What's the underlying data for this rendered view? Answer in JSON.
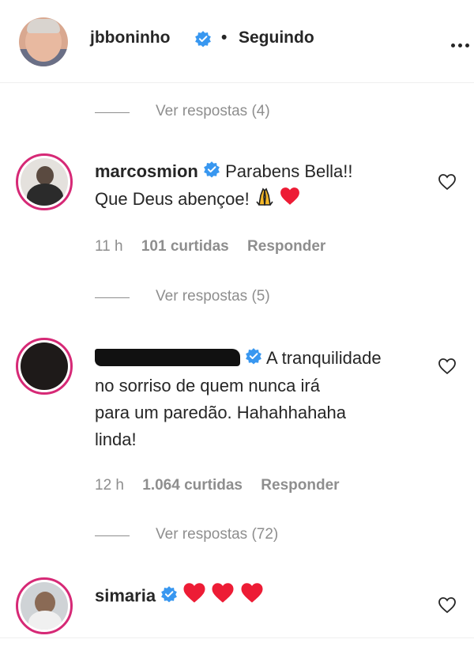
{
  "header": {
    "username": "jbboninho",
    "separator": "•",
    "follow_status": "Seguindo"
  },
  "threads": [
    {
      "replies_label": "Ver respostas (4)"
    },
    {
      "replies_label": "Ver respostas (5)"
    },
    {
      "replies_label": "Ver respostas (72)"
    }
  ],
  "comments": [
    {
      "username": "marcosmion",
      "text_line1": "Parabens Bella!!",
      "text_line2": "Que Deus abençoe!",
      "time": "11 h",
      "likes": "101 curtidas",
      "reply": "Responder"
    },
    {
      "username": "",
      "text_line1": "A tranquilidade",
      "text_line2": "no sorriso de quem nunca irá",
      "text_line3": "para um paredão. Hahahhahaha",
      "text_line4": "linda!",
      "time": "12 h",
      "likes": "1.064 curtidas",
      "reply": "Responder"
    },
    {
      "username": "simaria",
      "text_line1": ""
    }
  ],
  "colors": {
    "story_ring": "#d62976",
    "verified": "#3897f0",
    "heart": "#ed1c35",
    "muted": "#8e8e8e"
  },
  "icons": [
    "verified-badge-icon",
    "more-options-icon",
    "heart-outline-icon",
    "heart-emoji-icon",
    "praying-hands-emoji-icon"
  ]
}
